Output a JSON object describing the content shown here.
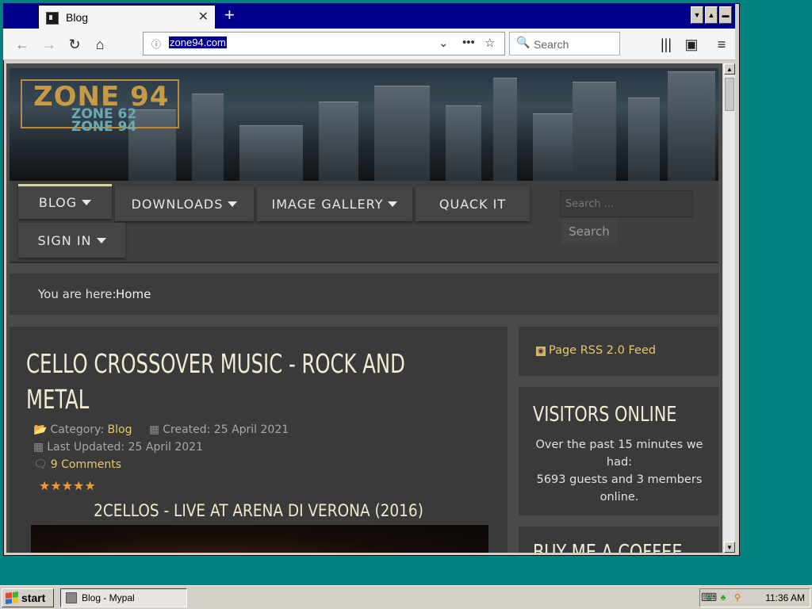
{
  "browser": {
    "tab_title": "Blog",
    "tab_close": "✕",
    "new_tab": "+",
    "url": "zone94.com",
    "search_placeholder": "Search"
  },
  "site": {
    "logo_main": "ZONE 94",
    "logo_sub1": "ZONE 62",
    "logo_sub2": "ZONE 94",
    "menu": [
      {
        "label": "BLOG"
      },
      {
        "label": "DOWNLOADS"
      },
      {
        "label": "IMAGE GALLERY"
      },
      {
        "label": "QUACK IT"
      },
      {
        "label": "SIGN IN"
      }
    ],
    "search_placeholder": "Search ...",
    "search_button": "Search",
    "breadcrumb_label": "You are here:",
    "breadcrumb_home": "Home"
  },
  "article": {
    "title": "CELLO CROSSOVER MUSIC - ROCK AND METAL",
    "category_label": "Category:",
    "category_value": "Blog",
    "created": "Created: 25 April 2021",
    "last_updated": "Last Updated: 25 April 2021",
    "comments": "9 Comments",
    "rating_stars": 5,
    "subheading": "2CELLOS - LIVE AT ARENA DI VERONA (2016)"
  },
  "sidebar": {
    "rss": "Page RSS 2.0 Feed",
    "visitors_title": "VISITORS ONLINE",
    "visitors_line1": "Over the past 15 minutes we had:",
    "visitors_line2": "5693 guests and 3 members online.",
    "coffee_title": "BUY ME A COFFEE"
  },
  "taskbar": {
    "start": "start",
    "task_label": "Blog - Mypal",
    "clock": "11:36 AM"
  }
}
